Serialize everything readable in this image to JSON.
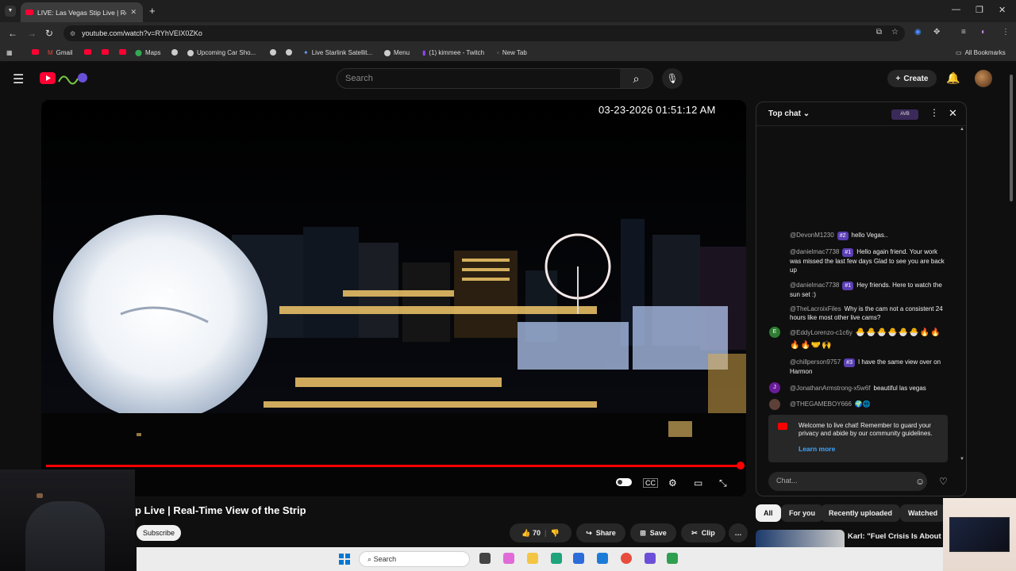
{
  "browser": {
    "tab_title": "LIVE: Las Vegas Stip Live | Real-",
    "url": "youtube.com/watch?v=RYhVEIX0ZKo",
    "bookmarks": [
      "Gmail",
      "Maps",
      "Upcoming Car Sho...",
      "Live Starlink Satellit...",
      "Menu",
      "(1) kimmee - Twitch",
      "New Tab"
    ],
    "all_bookmarks": "All Bookmarks"
  },
  "youtube": {
    "search_placeholder": "Search",
    "create_label": "Create"
  },
  "video": {
    "timestamp": "03-23-2026 01:51:12 AM",
    "title_visible": "p Live | Real-Time View of the Strip",
    "subscribe": "Subscribe",
    "likes": "70",
    "share": "Share",
    "save": "Save",
    "clip": "Clip"
  },
  "chat": {
    "header": "Top chat",
    "header_badge": "AVB",
    "messages": [
      {
        "user": "@DevonM1230",
        "badge": "#2",
        "text": "hello Vegas.."
      },
      {
        "user": "@danielmac7738",
        "badge": "#1",
        "text": "Hello again friend. Your work was missed the last few days Glad to see you are back up"
      },
      {
        "user": "@danielmac7738",
        "badge": "#1",
        "text": "Hey friends. Here to watch the sun set :)"
      },
      {
        "user": "@TheLacroixFiles",
        "badge": "",
        "text": "Why is the cam not a consistent 24 hours like most other live cams?"
      },
      {
        "user": "@EddyLorenzo-c1c6y",
        "badge": "",
        "avatar": "E",
        "text": "🐣🐣🐣🐣🐣🐣🔥🔥🔥🔥🤝🙌"
      },
      {
        "user": "@chillperson9757",
        "badge": "#3",
        "text": "I have the same view over on Harmon"
      },
      {
        "user": "@JonathanArmstrong-x5w6f",
        "badge": "",
        "avatar": "J",
        "text": "beautiful las vegas"
      },
      {
        "user": "@THEGAMEBOY666",
        "badge": "",
        "text": "🌍🌐"
      }
    ],
    "welcome_text": "Welcome to live chat! Remember to guard your privacy and abide by our community guidelines.",
    "learn_more": "Learn more",
    "input_placeholder": "Chat..."
  },
  "chips": [
    "All",
    "For you",
    "Recently uploaded",
    "Watched"
  ],
  "related": {
    "title": "Karl: \"Fuel Crisis Is About To"
  },
  "taskbar": {
    "search": "Search"
  },
  "colors": {
    "accent": "#ff0000",
    "link": "#3ea6ff",
    "badge": "#5b3fb5"
  }
}
